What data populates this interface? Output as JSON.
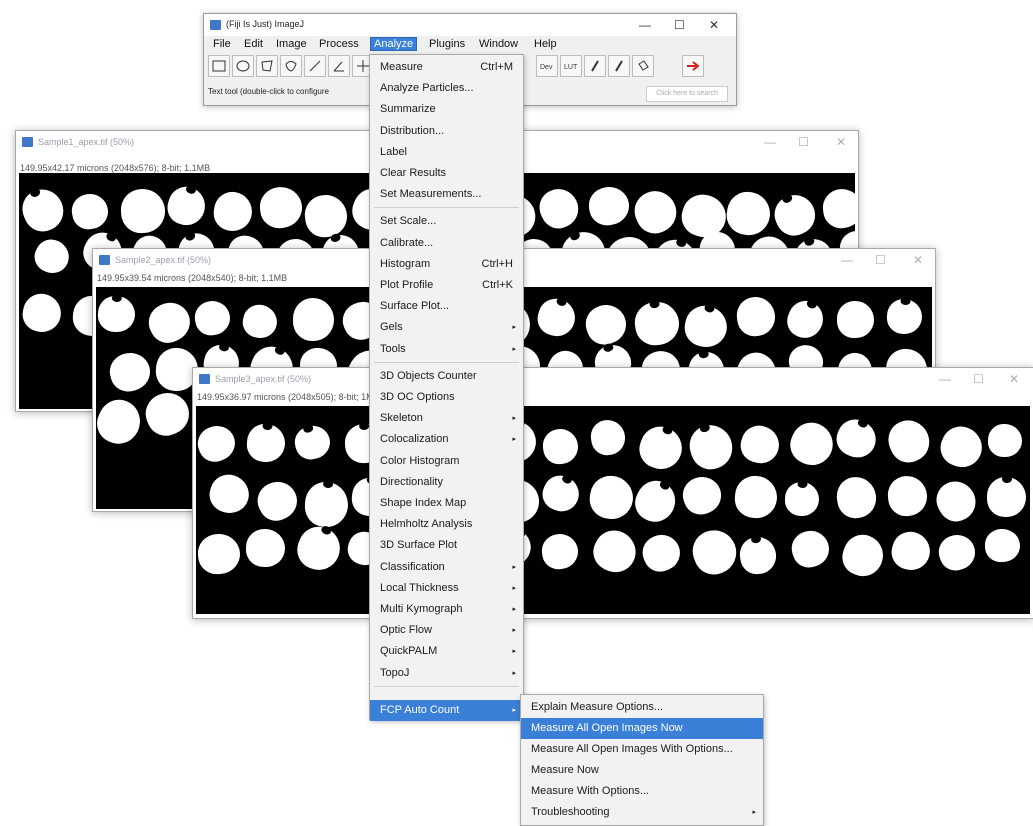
{
  "fiji": {
    "title": "(Fiji Is Just) ImageJ",
    "menus": [
      "File",
      "Edit",
      "Image",
      "Process",
      "Analyze",
      "Plugins",
      "Window",
      "Help"
    ],
    "status": "Text tool (double-click to configure",
    "search_placeholder": "Click here to search",
    "toolbar_text": [
      "Dev",
      "LUT"
    ]
  },
  "image_windows": [
    {
      "title": "Sample1_apex.tif (50%)",
      "info": "149.95x42.17 microns (2048x576); 8-bit; 1.1MB"
    },
    {
      "title": "Sample2_apex.tif (50%)",
      "info": "149.95x39.54 microns (2048x540); 8-bit; 1.1MB"
    },
    {
      "title": "Sample3_apex.tif (50%)",
      "info": "149.95x36.97 microns (2048x505); 8-bit; 1MB"
    }
  ],
  "window_controls": {
    "minimize": "—",
    "maximize": "☐",
    "close": "✕"
  },
  "analyze_menu": {
    "items": [
      {
        "label": "Measure",
        "shortcut": "Ctrl+M"
      },
      {
        "label": "Analyze Particles..."
      },
      {
        "label": "Summarize"
      },
      {
        "label": "Distribution..."
      },
      {
        "label": "Label"
      },
      {
        "label": "Clear Results"
      },
      {
        "label": "Set Measurements..."
      },
      {
        "label": "Set Scale..."
      },
      {
        "label": "Calibrate..."
      },
      {
        "label": "Histogram",
        "shortcut": "Ctrl+H"
      },
      {
        "label": "Plot Profile",
        "shortcut": "Ctrl+K"
      },
      {
        "label": "Surface Plot..."
      },
      {
        "label": "Gels",
        "submenu": "▸"
      },
      {
        "label": "Tools",
        "submenu": "▸"
      },
      {
        "label": "3D Objects Counter"
      },
      {
        "label": "3D OC Options"
      },
      {
        "label": "Skeleton",
        "submenu": "▸"
      },
      {
        "label": "Colocalization",
        "submenu": "▸"
      },
      {
        "label": "Color Histogram"
      },
      {
        "label": "Directionality"
      },
      {
        "label": "Shape Index Map"
      },
      {
        "label": "Helmholtz Analysis"
      },
      {
        "label": "3D Surface Plot"
      },
      {
        "label": "Classification",
        "submenu": "▸"
      },
      {
        "label": "Local Thickness",
        "submenu": "▸"
      },
      {
        "label": "Multi Kymograph",
        "submenu": "▸"
      },
      {
        "label": "Optic Flow",
        "submenu": "▸"
      },
      {
        "label": "QuickPALM",
        "submenu": "▸"
      },
      {
        "label": "TopoJ",
        "submenu": "▸"
      },
      {
        "label": "FCP Auto Count",
        "submenu": "▸"
      }
    ]
  },
  "fcp_submenu": {
    "items": [
      {
        "label": "Explain Measure Options..."
      },
      {
        "label": "Measure All Open Images Now"
      },
      {
        "label": "Measure All Open Images With Options..."
      },
      {
        "label": "Measure Now"
      },
      {
        "label": "Measure With Options..."
      },
      {
        "label": "Troubleshooting",
        "submenu": "▸"
      }
    ]
  },
  "colors": {
    "highlight": "#3a7fd8",
    "menu_bg": "#f2f2f2",
    "image_bg": "#000000",
    "cell": "#ffffff"
  }
}
